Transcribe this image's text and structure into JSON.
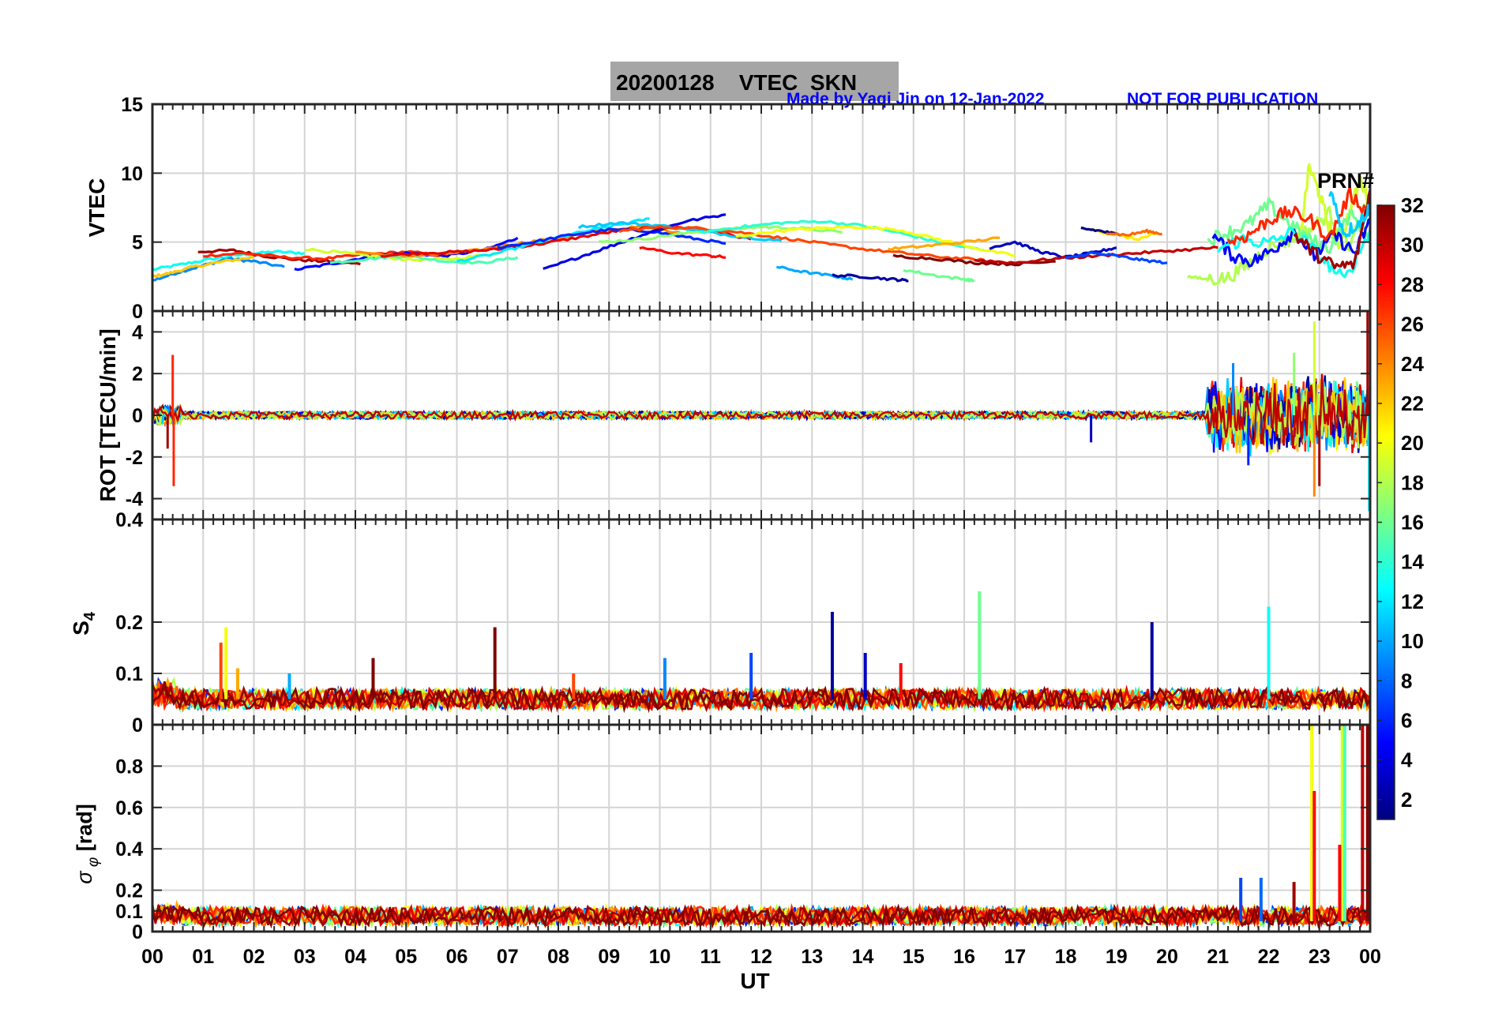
{
  "header": {
    "title": "20200128    VTEC  SKN",
    "credit": "Made by Yaqi Jin on 12-Jan-2022",
    "notice": "NOT FOR PUBLICATION",
    "title_bg": "#a6a6a6",
    "credit_color": "#0000ff"
  },
  "chart_data": {
    "type": "line",
    "x_axis": {
      "label": "UT",
      "range": [
        0,
        24
      ],
      "tick_labels": [
        "00",
        "01",
        "02",
        "03",
        "04",
        "05",
        "06",
        "07",
        "08",
        "09",
        "10",
        "11",
        "12",
        "13",
        "14",
        "15",
        "16",
        "17",
        "18",
        "19",
        "20",
        "21",
        "22",
        "23",
        "00"
      ]
    },
    "grid": true,
    "colormap": "jet",
    "colorbar": {
      "title": "PRN#",
      "range": [
        1,
        32
      ],
      "ticks": [
        "2",
        "4",
        "6",
        "8",
        "10",
        "12",
        "14",
        "16",
        "18",
        "20",
        "22",
        "24",
        "26",
        "28",
        "30",
        "32"
      ]
    },
    "panels": [
      {
        "id": "vtec",
        "ylabel": "VTEC",
        "ylim": [
          0,
          15
        ],
        "yticks": [
          "0",
          "5",
          "10",
          "15"
        ],
        "arcs": [
          {
            "prn": 13,
            "x": [
              0.0,
              0.6,
              1.2,
              1.8,
              2.4,
              3.0
            ],
            "y": [
              3.0,
              3.4,
              3.8,
              4.1,
              4.3,
              4.2
            ]
          },
          {
            "prn": 9,
            "x": [
              0.0,
              0.5,
              1.0,
              1.5,
              2.0,
              2.6
            ],
            "y": [
              2.2,
              2.8,
              3.3,
              3.8,
              3.6,
              3.2
            ]
          },
          {
            "prn": 22,
            "x": [
              0.0,
              0.4,
              0.8,
              1.4,
              2.0
            ],
            "y": [
              2.5,
              2.8,
              3.2,
              3.6,
              3.9
            ]
          },
          {
            "prn": 31,
            "x": [
              0.9,
              1.6,
              2.2,
              2.9,
              3.5,
              4.1
            ],
            "y": [
              4.3,
              4.4,
              4.0,
              3.7,
              3.6,
              3.4
            ]
          },
          {
            "prn": 27,
            "x": [
              1.0,
              1.8,
              2.6,
              3.4,
              4.2,
              5.0,
              5.8
            ],
            "y": [
              4.0,
              4.2,
              3.9,
              3.8,
              4.1,
              4.3,
              4.0
            ]
          },
          {
            "prn": 5,
            "x": [
              2.8,
              3.5,
              4.2,
              5.0,
              5.8,
              6.6,
              7.2
            ],
            "y": [
              3.0,
              3.4,
              3.9,
              4.2,
              4.0,
              4.5,
              5.3
            ]
          },
          {
            "prn": 19,
            "x": [
              3.0,
              3.8,
              4.5,
              5.2,
              6.0,
              6.8
            ],
            "y": [
              4.5,
              4.2,
              3.9,
              3.7,
              3.8,
              4.2
            ]
          },
          {
            "prn": 15,
            "x": [
              3.5,
              4.3,
              5.0,
              5.8,
              6.5,
              7.2
            ],
            "y": [
              3.5,
              3.8,
              4.0,
              3.6,
              3.5,
              3.9
            ]
          },
          {
            "prn": 24,
            "x": [
              4.0,
              4.8,
              5.6,
              6.4,
              7.2,
              8.0,
              8.8,
              9.6,
              10.4
            ],
            "y": [
              4.3,
              4.0,
              4.1,
              4.4,
              4.9,
              5.3,
              5.8,
              6.1,
              5.7
            ]
          },
          {
            "prn": 29,
            "x": [
              4.5,
              5.3,
              6.1,
              6.9,
              7.7,
              8.5,
              9.3,
              10.2,
              11.0,
              11.8
            ],
            "y": [
              4.0,
              4.2,
              4.3,
              4.5,
              4.9,
              5.4,
              5.9,
              6.1,
              5.8,
              5.2
            ]
          },
          {
            "prn": 12,
            "x": [
              6.0,
              6.8,
              7.5,
              8.3,
              9.1,
              9.8
            ],
            "y": [
              3.6,
              4.2,
              4.9,
              5.6,
              6.2,
              6.7
            ]
          },
          {
            "prn": 6,
            "x": [
              6.8,
              7.5,
              8.2,
              9.0,
              9.8,
              10.6,
              11.3
            ],
            "y": [
              4.6,
              5.0,
              5.5,
              5.9,
              5.8,
              5.3,
              4.9
            ]
          },
          {
            "prn": 4,
            "x": [
              7.7,
              8.4,
              9.1,
              9.8,
              10.5,
              11.3
            ],
            "y": [
              3.0,
              3.9,
              4.8,
              5.7,
              6.5,
              7.0
            ]
          },
          {
            "prn": 11,
            "x": [
              8.4,
              9.2,
              10.0,
              10.8,
              11.6,
              12.4
            ],
            "y": [
              6.1,
              6.4,
              6.2,
              5.8,
              5.4,
              5.1
            ]
          },
          {
            "prn": 17,
            "x": [
              8.8,
              9.6,
              10.4,
              11.2,
              12.0,
              12.8,
              13.6
            ],
            "y": [
              5.0,
              5.2,
              5.6,
              5.9,
              6.1,
              6.0,
              5.7
            ]
          },
          {
            "prn": 26,
            "x": [
              9.2,
              10.0,
              10.8,
              11.6,
              12.4,
              13.2,
              14.0,
              14.8,
              15.6,
              16.4
            ],
            "y": [
              5.8,
              6.1,
              6.0,
              5.7,
              5.3,
              4.9,
              4.5,
              4.2,
              3.9,
              3.7
            ]
          },
          {
            "prn": 14,
            "x": [
              10.8,
              11.6,
              12.4,
              13.2,
              14.0,
              14.8,
              15.6,
              16.4
            ],
            "y": [
              5.7,
              6.1,
              6.4,
              6.5,
              6.2,
              5.6,
              4.9,
              4.4
            ]
          },
          {
            "prn": 20,
            "x": [
              11.5,
              12.3,
              13.1,
              13.9,
              14.7,
              15.5,
              16.3,
              17.0
            ],
            "y": [
              5.4,
              5.8,
              6.0,
              6.1,
              5.9,
              5.2,
              4.5,
              4.0
            ]
          },
          {
            "prn": 28,
            "x": [
              9.6,
              10.3,
              11.0,
              11.3
            ],
            "y": [
              4.6,
              4.2,
              4.0,
              3.9
            ]
          },
          {
            "prn": 10,
            "x": [
              12.3,
              12.9,
              13.5,
              13.8
            ],
            "y": [
              3.2,
              2.8,
              2.5,
              2.3
            ]
          },
          {
            "prn": 2,
            "x": [
              13.4,
              14.0,
              14.6,
              14.9
            ],
            "y": [
              2.6,
              2.5,
              2.3,
              2.2
            ]
          },
          {
            "prn": 16,
            "x": [
              14.8,
              15.4,
              16.0,
              16.2
            ],
            "y": [
              3.0,
              2.6,
              2.3,
              2.2
            ]
          },
          {
            "prn": 23,
            "x": [
              14.5,
              15.2,
              16.0,
              16.7
            ],
            "y": [
              4.5,
              4.7,
              5.0,
              5.3
            ]
          },
          {
            "prn": 32,
            "x": [
              14.6,
              15.4,
              16.2,
              17.0,
              17.8
            ],
            "y": [
              4.0,
              3.8,
              3.5,
              3.4,
              3.6
            ]
          },
          {
            "prn": 3,
            "x": [
              16.5,
              17.0,
              17.5,
              18.0,
              18.5,
              19.0
            ],
            "y": [
              4.6,
              5.0,
              4.3,
              3.9,
              4.2,
              4.6
            ]
          },
          {
            "prn": 30,
            "x": [
              16.2,
              17.0,
              17.8,
              18.6,
              19.4,
              20.2,
              21.0
            ],
            "y": [
              3.7,
              3.5,
              3.8,
              4.0,
              4.2,
              4.4,
              4.6
            ]
          },
          {
            "prn": 7,
            "x": [
              18.0,
              18.5,
              19.0,
              19.5,
              20.0
            ],
            "y": [
              3.8,
              4.2,
              4.0,
              3.7,
              3.5
            ]
          },
          {
            "prn": 21,
            "x": [
              18.5,
              18.9,
              19.4,
              19.8
            ],
            "y": [
              5.9,
              5.6,
              5.2,
              5.6
            ]
          },
          {
            "prn": 1,
            "x": [
              18.3,
              18.7,
              19.1
            ],
            "y": [
              6.0,
              5.8,
              5.5
            ]
          },
          {
            "prn": 25,
            "x": [
              18.8,
              19.2,
              19.6,
              19.9
            ],
            "y": [
              5.7,
              5.5,
              5.8,
              5.6
            ]
          },
          {
            "prn": 18,
            "x": [
              20.4,
              20.8,
              21.2,
              21.6,
              22.0,
              22.4,
              22.8,
              23.2,
              23.6,
              24.0
            ],
            "y": [
              2.5,
              2.3,
              2.4,
              3.4,
              4.6,
              5.1,
              5.9,
              7.1,
              4.7,
              8.3
            ]
          },
          {
            "prn": 19,
            "x": [
              22.6,
              22.8,
              23.0,
              23.2,
              23.4,
              23.6,
              23.8,
              24.0
            ],
            "y": [
              4.8,
              10.5,
              8.5,
              6.0,
              4.8,
              7.2,
              9.5,
              8.0
            ]
          },
          {
            "prn": 16,
            "x": [
              20.8,
              21.2,
              21.6,
              22.0,
              22.4,
              22.8,
              23.2,
              23.6,
              24.0
            ],
            "y": [
              5.2,
              5.7,
              6.3,
              7.7,
              6.4,
              5.2,
              4.6,
              7.0,
              5.5
            ]
          },
          {
            "prn": 5,
            "x": [
              20.9,
              21.3,
              21.7,
              22.1,
              22.5,
              22.9,
              23.3,
              23.7,
              24.0
            ],
            "y": [
              5.5,
              4.0,
              3.6,
              4.5,
              5.8,
              4.0,
              5.5,
              4.2,
              6.5
            ]
          },
          {
            "prn": 13,
            "x": [
              21.0,
              21.5,
              22.0,
              22.5,
              23.0,
              23.5,
              24.0
            ],
            "y": [
              4.5,
              5.2,
              4.9,
              5.8,
              4.0,
              2.2,
              5.9
            ]
          },
          {
            "prn": 27,
            "x": [
              21.2,
              21.6,
              22.0,
              22.4,
              22.8,
              23.2,
              23.6,
              24.0
            ],
            "y": [
              5.0,
              5.5,
              6.6,
              7.2,
              6.7,
              5.3,
              8.5,
              7.0
            ]
          },
          {
            "prn": 31,
            "x": [
              22.5,
              22.9,
              23.3,
              23.7,
              24.0
            ],
            "y": [
              5.6,
              4.2,
              3.2,
              3.4,
              8.8
            ]
          },
          {
            "prn": 11,
            "x": [
              23.2,
              23.5,
              23.8,
              24.0
            ],
            "y": [
              8.8,
              5.6,
              6.5,
              7.5
            ]
          }
        ]
      },
      {
        "id": "rot",
        "ylabel": "ROT [TECU/min]",
        "ylim": [
          -5,
          5
        ],
        "yticks": [
          "-4",
          "-2",
          "0",
          "2",
          "4"
        ],
        "quiet_band": [
          0.0,
          20.8,
          0.35
        ],
        "spikes": [
          {
            "prn": 27,
            "x": 0.4,
            "y": 2.9
          },
          {
            "prn": 27,
            "x": 0.42,
            "y": -3.4
          },
          {
            "prn": 31,
            "x": 0.3,
            "y": -1.6
          },
          {
            "prn": 3,
            "x": 18.5,
            "y": -1.3
          },
          {
            "prn": 6,
            "x": 21.6,
            "y": -2.4
          },
          {
            "prn": 19,
            "x": 22.9,
            "y": 4.5
          },
          {
            "prn": 24,
            "x": 22.9,
            "y": -3.9
          },
          {
            "prn": 31,
            "x": 23.0,
            "y": -3.4
          },
          {
            "prn": 31,
            "x": 23.95,
            "y": 5.0
          },
          {
            "prn": 12,
            "x": 23.98,
            "y": -4.6
          },
          {
            "prn": 9,
            "x": 21.3,
            "y": 2.5
          },
          {
            "prn": 17,
            "x": 22.5,
            "y": 3.0
          }
        ],
        "active_band": [
          20.8,
          24.0,
          2.5
        ]
      },
      {
        "id": "s4",
        "ylabel": "S4",
        "ylim": [
          0,
          0.4
        ],
        "yticks": [
          "0",
          "0.1",
          "0.2",
          "0.4"
        ],
        "baseline": [
          0.03,
          0.07
        ],
        "spikes": [
          {
            "prn": 26,
            "x": 1.35,
            "y": 0.16
          },
          {
            "prn": 20,
            "x": 1.45,
            "y": 0.19
          },
          {
            "prn": 23,
            "x": 1.68,
            "y": 0.11
          },
          {
            "prn": 10,
            "x": 2.7,
            "y": 0.1
          },
          {
            "prn": 32,
            "x": 4.35,
            "y": 0.13
          },
          {
            "prn": 32,
            "x": 6.75,
            "y": 0.19
          },
          {
            "prn": 26,
            "x": 8.3,
            "y": 0.1
          },
          {
            "prn": 9,
            "x": 10.1,
            "y": 0.13
          },
          {
            "prn": 7,
            "x": 11.8,
            "y": 0.14
          },
          {
            "prn": 2,
            "x": 13.4,
            "y": 0.22
          },
          {
            "prn": 3,
            "x": 14.05,
            "y": 0.14
          },
          {
            "prn": 28,
            "x": 14.75,
            "y": 0.12
          },
          {
            "prn": 16,
            "x": 16.3,
            "y": 0.26
          },
          {
            "prn": 2,
            "x": 19.7,
            "y": 0.2
          },
          {
            "prn": 13,
            "x": 22.0,
            "y": 0.23
          }
        ]
      },
      {
        "id": "sigma_phi",
        "ylabel": "σ φ [rad]",
        "ylim": [
          0,
          1
        ],
        "yticks": [
          "0",
          "0.1",
          "0.2",
          "0.4",
          "0.6",
          "0.8"
        ],
        "baseline": [
          0.03,
          0.12
        ],
        "spikes": [
          {
            "prn": 7,
            "x": 21.45,
            "y": 0.26
          },
          {
            "prn": 8,
            "x": 21.85,
            "y": 0.26
          },
          {
            "prn": 31,
            "x": 22.5,
            "y": 0.24
          },
          {
            "prn": 20,
            "x": 22.85,
            "y": 1.0
          },
          {
            "prn": 28,
            "x": 22.9,
            "y": 0.68
          },
          {
            "prn": 19,
            "x": 23.45,
            "y": 1.0
          },
          {
            "prn": 15,
            "x": 23.5,
            "y": 1.0
          },
          {
            "prn": 28,
            "x": 23.4,
            "y": 0.42
          },
          {
            "prn": 32,
            "x": 23.95,
            "y": 1.0
          },
          {
            "prn": 30,
            "x": 23.85,
            "y": 1.0
          }
        ]
      }
    ]
  }
}
